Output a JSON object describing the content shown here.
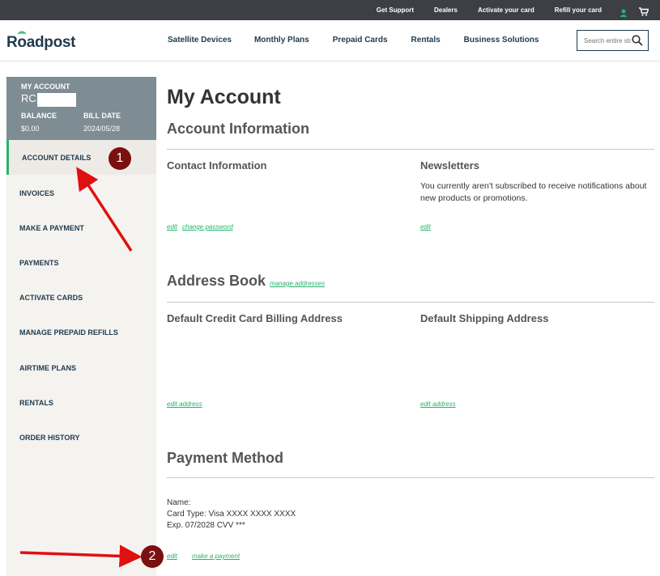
{
  "topbar": {
    "links": [
      "Get Support",
      "Dealers",
      "Activate your card",
      "Refill your card"
    ],
    "icons": [
      "user-icon",
      "cart-icon"
    ],
    "user_icon_color": "#27b36b"
  },
  "header": {
    "logo_text": "Roadpost",
    "nav": [
      "Satellite Devices",
      "Monthly Plans",
      "Prepaid Cards",
      "Rentals",
      "Business Solutions"
    ],
    "search_placeholder": "Search entire store here..."
  },
  "sidebar": {
    "account_label": "MY ACCOUNT",
    "account_id": "RC",
    "balance_label": "BALANCE",
    "balance_value": "$0.00",
    "bill_date_label": "BILL DATE",
    "bill_date_value": "2024/05/28",
    "items": [
      {
        "label": "ACCOUNT DETAILS",
        "active": true
      },
      {
        "label": "INVOICES"
      },
      {
        "label": "MAKE A PAYMENT"
      },
      {
        "label": "PAYMENTS"
      },
      {
        "label": "ACTIVATE CARDS"
      },
      {
        "label": "MANAGE PREPAID REFILLS"
      },
      {
        "label": "AIRTIME PLANS"
      },
      {
        "label": "RENTALS"
      },
      {
        "label": "ORDER HISTORY"
      }
    ],
    "accent_color": "#27b36b"
  },
  "main": {
    "title": "My Account",
    "account_info": {
      "title": "Account Information",
      "contact_title": "Contact Information",
      "contact_edit": "edit",
      "contact_change_password": "change password",
      "newsletters_title": "Newsletters",
      "newsletters_text": "You currently aren't subscribed to receive notifications about new products or promotions.",
      "newsletters_edit": "edit"
    },
    "address_book": {
      "title": "Address Book",
      "manage_link": "manage addresses",
      "billing_title": "Default Credit Card Billing Address",
      "billing_edit": "edit address",
      "shipping_title": "Default Shipping Address",
      "shipping_edit": "edit address"
    },
    "payment_method": {
      "title": "Payment Method",
      "name_line": "Name:",
      "card_type_line": "Card Type: Visa XXXX XXXX XXXX",
      "exp_line": "Exp. 07/2028 CVV ***",
      "edit": "edit",
      "make_payment": "make a payment"
    }
  },
  "annotations": {
    "badge_1": "1",
    "badge_2": "2",
    "badge_color": "#7a1010",
    "arrow_color": "#e01010"
  }
}
